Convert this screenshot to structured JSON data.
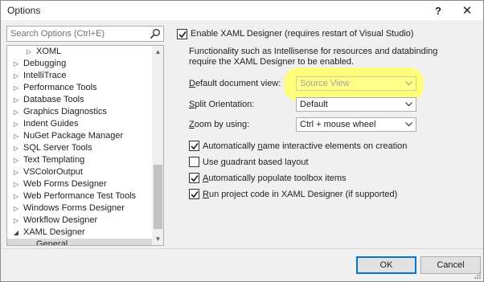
{
  "window": {
    "title": "Options",
    "help_label": "?",
    "close_label": "✕"
  },
  "search": {
    "placeholder": "Search Options (Ctrl+E)"
  },
  "tree": {
    "items": [
      {
        "label": "XOML",
        "expanded": false
      },
      {
        "label": "Debugging",
        "expanded": false
      },
      {
        "label": "IntelliTrace",
        "expanded": false
      },
      {
        "label": "Performance Tools",
        "expanded": false
      },
      {
        "label": "Database Tools",
        "expanded": false
      },
      {
        "label": "Graphics Diagnostics",
        "expanded": false
      },
      {
        "label": "Indent Guides",
        "expanded": false
      },
      {
        "label": "NuGet Package Manager",
        "expanded": false
      },
      {
        "label": "SQL Server Tools",
        "expanded": false
      },
      {
        "label": "Text Templating",
        "expanded": false
      },
      {
        "label": "VSColorOutput",
        "expanded": false
      },
      {
        "label": "Web Forms Designer",
        "expanded": false
      },
      {
        "label": "Web Performance Test Tools",
        "expanded": false
      },
      {
        "label": "Windows Forms Designer",
        "expanded": false
      },
      {
        "label": "Workflow Designer",
        "expanded": false
      },
      {
        "label": "XAML Designer",
        "expanded": true
      },
      {
        "label": "General",
        "selected": true
      }
    ]
  },
  "settings": {
    "enable_designer": {
      "label": "Enable XAML Designer (requires restart of Visual Studio)",
      "checked": true
    },
    "description": "Functionality such as Intellisense for resources and databinding require the XAML Designer to be enabled.",
    "default_view": {
      "label_pre": "",
      "label_u": "D",
      "label_post": "efault document view:",
      "value": "Source View",
      "disabled": true
    },
    "split_orientation": {
      "label_pre": "",
      "label_u": "S",
      "label_post": "plit Orientation:",
      "value": "Default"
    },
    "zoom_by": {
      "label_pre": "",
      "label_u": "Z",
      "label_post": "oom by using:",
      "value": "Ctrl + mouse wheel"
    },
    "auto_name": {
      "label_pre": "Automatically ",
      "label_u": "n",
      "label_post": "ame interactive elements on creation",
      "checked": true
    },
    "quadrant_layout": {
      "label_pre": "Use ",
      "label_u": "q",
      "label_post": "uadrant based layout",
      "checked": false
    },
    "populate_toolbox": {
      "label_pre": "",
      "label_u": "A",
      "label_post": "utomatically populate toolbox items",
      "checked": true
    },
    "run_project_code": {
      "label_pre": "",
      "label_u": "R",
      "label_post": "un project code in XAML Designer (if supported)",
      "checked": true
    }
  },
  "buttons": {
    "ok": "OK",
    "cancel": "Cancel"
  },
  "colors": {
    "highlight": "#ffff66",
    "selected_item": "#d9d9d9",
    "default_button_border": "#0078d7"
  }
}
